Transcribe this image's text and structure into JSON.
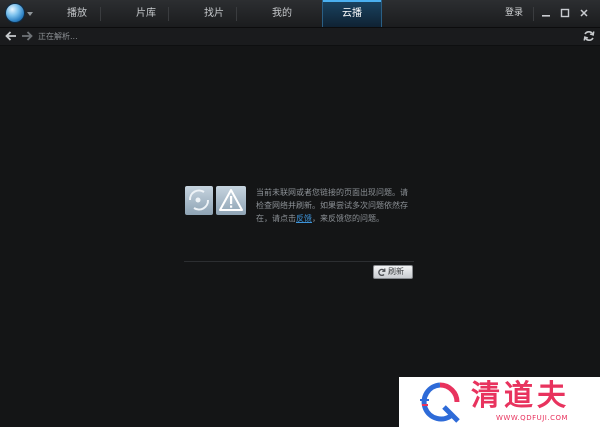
{
  "header": {
    "tabs": [
      {
        "label": "播放",
        "active": false
      },
      {
        "label": "片库",
        "active": false
      },
      {
        "label": "找片",
        "active": false
      },
      {
        "label": "我的",
        "active": false
      },
      {
        "label": "云播",
        "active": true
      }
    ],
    "login_label": "登录",
    "window_controls": [
      "minimize-icon",
      "restore-icon",
      "close-icon"
    ]
  },
  "nav": {
    "status": "正在解析...",
    "icons": [
      "back-arrow-icon",
      "forward-arrow-icon",
      "reload-icon"
    ]
  },
  "error": {
    "message_line1": "当前未联网或者您链接的页面出现问题。请",
    "message_line2": "检查网络并刷新。如果尝试多次问题依然存",
    "message_line3_pre": "在，请点击",
    "link": "反馈",
    "message_line3_post": "，来反馈您的问题。",
    "refresh_label": "刷新"
  },
  "watermark": {
    "title": "清道夫",
    "url": "WWW.QDFUJI.COM"
  },
  "colors": {
    "background": "#141516",
    "accent": "#4ab0f0",
    "link": "#3d93d8",
    "watermark": "#e8335e"
  }
}
